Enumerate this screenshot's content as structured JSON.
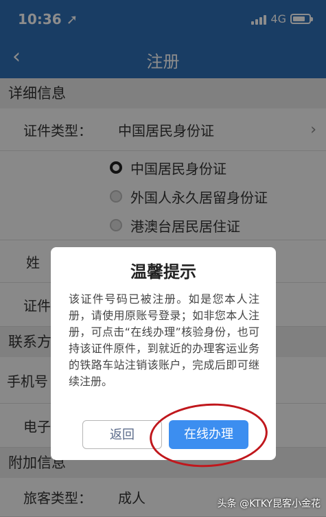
{
  "status_bar": {
    "time": "10:36 ➚",
    "network": "4G",
    "battery_level": 0.75
  },
  "nav": {
    "back_glyph": "‹",
    "title": "注册"
  },
  "form": {
    "section_detail": "详细信息",
    "id_type_label": "证件类型：",
    "id_type_value": "中国居民身份证",
    "id_type_options": [
      "中国居民身份证",
      "外国人永久居留身份证",
      "港澳台居民居住证"
    ],
    "surname_label": "姓",
    "id_number_label": "证件",
    "section_contact": "联系方",
    "phone_label": "手机号",
    "email_label": "电子",
    "section_extra": "附加信息",
    "passenger_type_label": "旅客类型：",
    "passenger_type_value": "成人"
  },
  "dialog": {
    "title": "温馨提示",
    "message": "该证件号码已被注册。如是您本人注册，请使用原账号登录；如非您本人注册，可点击“在线办理”核验身份，也可持该证件原件，到就近的办理客运业务的铁路车站注销该账户，完成后即可继续注册。",
    "back_button": "返回",
    "online_button": "在线办理"
  },
  "watermark": "头条 @KTKY昆客小金花",
  "colors": {
    "nav_blue": "#2f6fb7",
    "primary_button": "#3c8ef0",
    "highlight_red": "#c0171c"
  }
}
